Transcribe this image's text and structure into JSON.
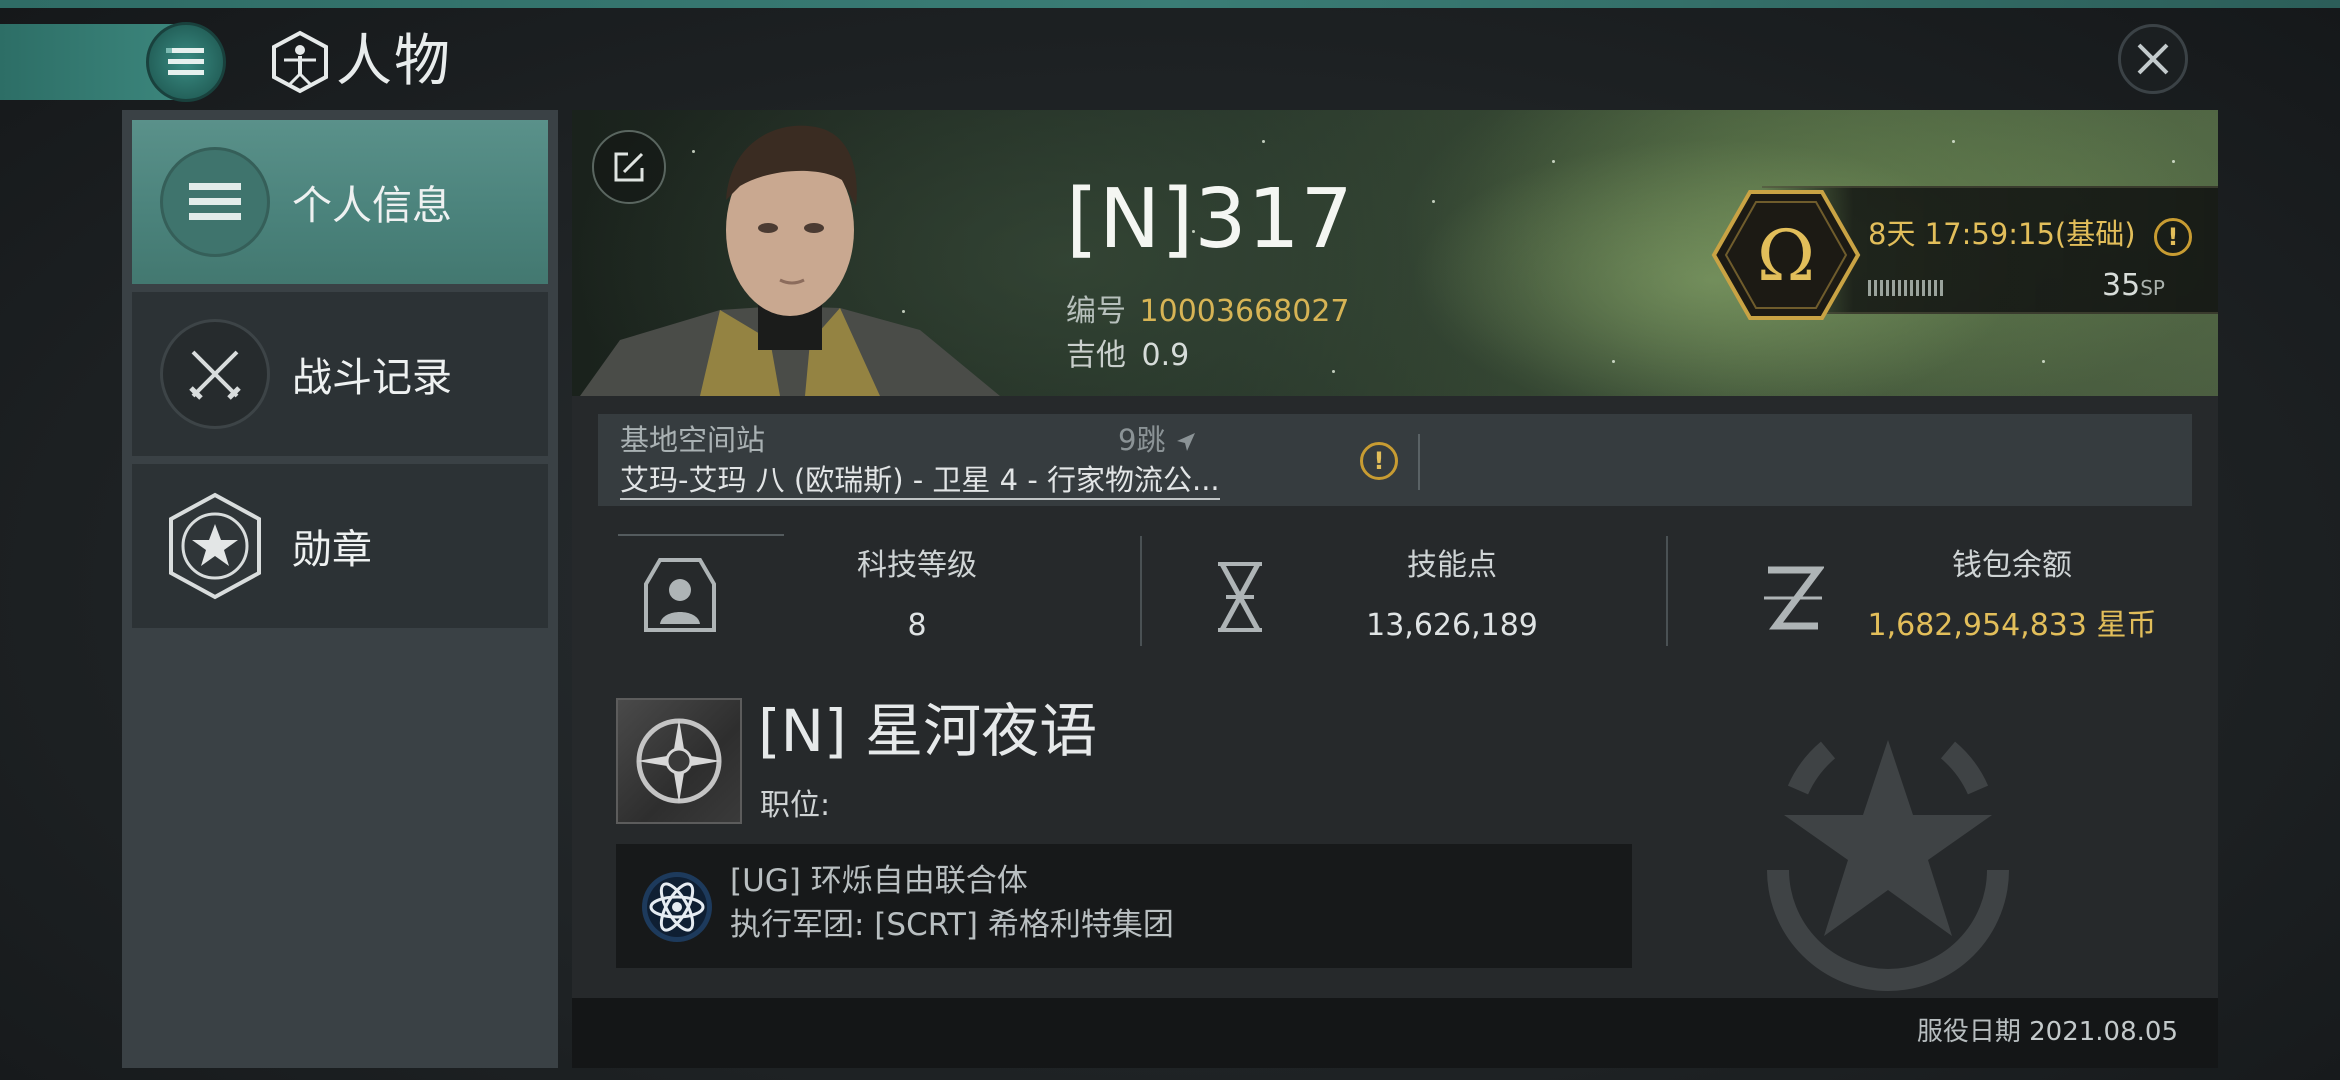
{
  "header": {
    "title": "人物"
  },
  "sidebar": {
    "items": [
      {
        "label": "个人信息",
        "icon": "list-icon",
        "active": true
      },
      {
        "label": "战斗记录",
        "icon": "crossed-swords-icon",
        "active": false
      },
      {
        "label": "勋章",
        "icon": "star-badge-icon",
        "active": false
      }
    ]
  },
  "character": {
    "name": "[N]317",
    "id_label": "编号",
    "id_value": "10003668027",
    "security_label": "吉他",
    "security_value": "0.9"
  },
  "omega": {
    "time_text": "8天 17:59:15(基础)",
    "sp_value": "35",
    "sp_unit": "SP"
  },
  "location": {
    "label": "基地空间站",
    "jumps": "9跳",
    "station": "艾玛-艾玛 八 (欧瑞斯) - 卫星 4 - 行家物流公..."
  },
  "stats": [
    {
      "label": "科技等级",
      "value": "8",
      "icon": "tech-level-icon"
    },
    {
      "label": "技能点",
      "value": "13,626,189",
      "icon": "skill-points-icon"
    },
    {
      "label": "钱包余额",
      "value": "1,682,954,833 星币",
      "icon": "isk-wallet-icon"
    }
  ],
  "corporation": {
    "name": "[N] 星河夜语",
    "role_label": "职位:",
    "alliance": "[UG] 环烁自由联合体",
    "faction": "执行军团: [SCRT] 希格利特集团"
  },
  "footer": {
    "service_label": "服役日期",
    "service_date": "2021.08.05"
  },
  "colors": {
    "accent_teal": "#4a827b",
    "gold": "#d7b455",
    "warning": "#c89c32"
  }
}
